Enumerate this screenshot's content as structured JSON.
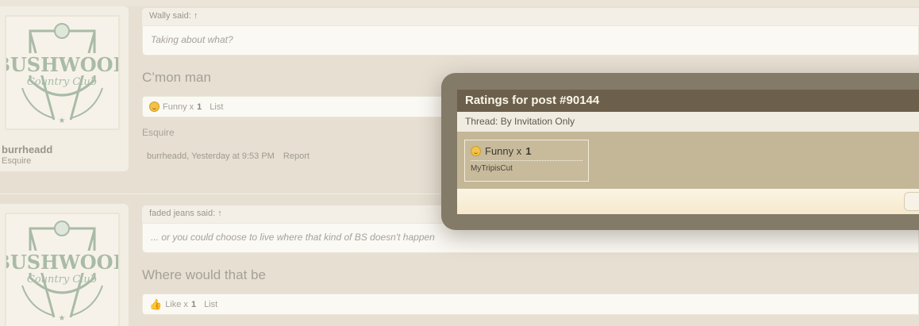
{
  "posts": [
    {
      "quote_author": "Wally said: ↑",
      "quote_text": "Taking about what?",
      "message": "C’mon man",
      "rating_label": "Funny x",
      "rating_count": "1",
      "list_label": "List",
      "signature": "Esquire",
      "meta": "burrheadd, Yesterday at 9:53 PM",
      "report_label": "Report",
      "username": "burrheadd",
      "user_title": "Esquire",
      "avatar_text": "BUSHWOOD",
      "avatar_sub": "Country Club"
    },
    {
      "quote_author": "faded jeans said: ↑",
      "quote_text": "... or you could choose to live where that kind of BS doesn't happen",
      "message": "Where would that be",
      "rating_label": "Like x",
      "rating_count": "1",
      "list_label": "List",
      "avatar_text": "BUSHWOOD",
      "avatar_sub": "Country Club"
    }
  ],
  "overlay": {
    "title": "Ratings for post #90144",
    "thread_prefix": "Thread:",
    "thread_name": "By Invitation Only",
    "rating_label": "Funny x",
    "rating_count": "1",
    "rater": "MyTripisCut"
  },
  "colors": {
    "background": "#e6dfd2",
    "overlay_frame": "#847a68",
    "overlay_title": "#6c604c",
    "overlay_body": "#c3b797",
    "emoticon": "#f3c24a"
  }
}
